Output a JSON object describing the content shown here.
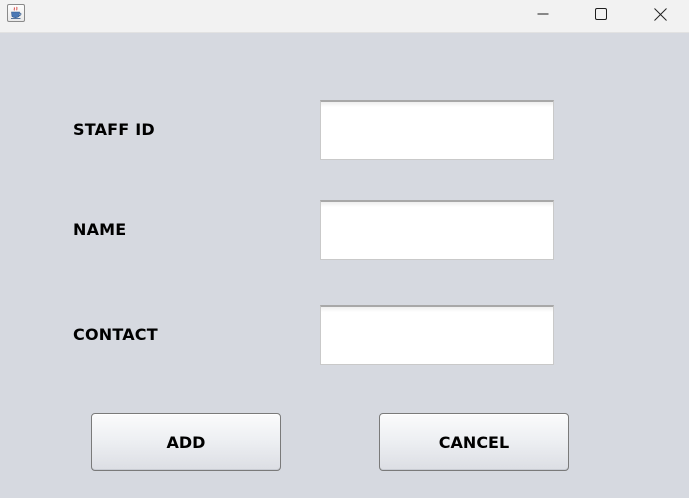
{
  "window": {
    "title": "",
    "icon": "java-cup-icon",
    "controls": [
      "minimize-icon",
      "maximize-icon",
      "close-icon"
    ]
  },
  "form": {
    "fields": [
      {
        "label": "STAFF ID",
        "value": ""
      },
      {
        "label": "NAME",
        "value": ""
      },
      {
        "label": "CONTACT",
        "value": ""
      }
    ],
    "buttons": {
      "add_label": "ADD",
      "cancel_label": "CANCEL"
    }
  },
  "colors": {
    "background": "#d6d9e0",
    "titlebar": "#f2f2f2",
    "field_background": "#ffffff"
  }
}
